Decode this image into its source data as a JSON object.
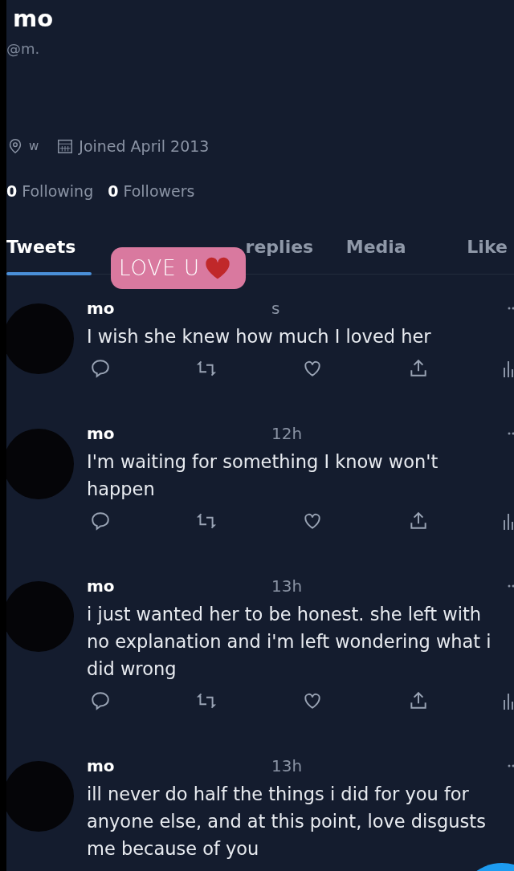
{
  "profile": {
    "name": "mo",
    "handle": "@m.",
    "location": "w",
    "joined": "Joined April 2013"
  },
  "stats": [
    {
      "count": "0",
      "label": "Following"
    },
    {
      "count": "0",
      "label": "Followers"
    }
  ],
  "tabs": [
    {
      "label": "Tweets",
      "selected": true
    },
    {
      "label": "replies",
      "selected": false
    },
    {
      "label": "Media",
      "selected": false
    },
    {
      "label": "Like",
      "selected": false
    }
  ],
  "sticker": {
    "text": "LOVE U"
  },
  "tweets": [
    {
      "name": "mo",
      "time": "s",
      "text": "I wish she knew how much I loved her"
    },
    {
      "name": "mo",
      "time": "12h",
      "text": "I'm waiting for something I know won't happen"
    },
    {
      "name": "mo",
      "time": "13h",
      "text": "i just wanted her to be honest. she left with no explanation and i'm left wondering what i did wrong"
    },
    {
      "name": "mo",
      "time": "13h",
      "text": "ill never do half the things i did for you for anyone else, and at this point, love disgusts me because of you"
    }
  ]
}
